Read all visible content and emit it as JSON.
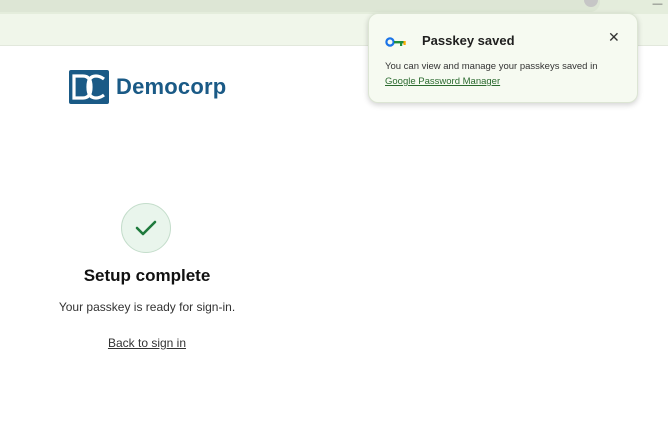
{
  "brand": {
    "logo_initials": "DC",
    "name": "Democorp",
    "color": "#1a5a86"
  },
  "status": {
    "title": "Setup complete",
    "message": "Your passkey is ready for sign-in.",
    "back_link": "Back to sign in",
    "check_color": "#1e8e3e"
  },
  "popup": {
    "title": "Passkey saved",
    "body_text": "You can view and manage your passkeys saved in",
    "link_text": "Google Password Manager",
    "close_glyph": "✕",
    "icon": "key-icon"
  },
  "browser": {
    "minimize_glyph": "—"
  }
}
